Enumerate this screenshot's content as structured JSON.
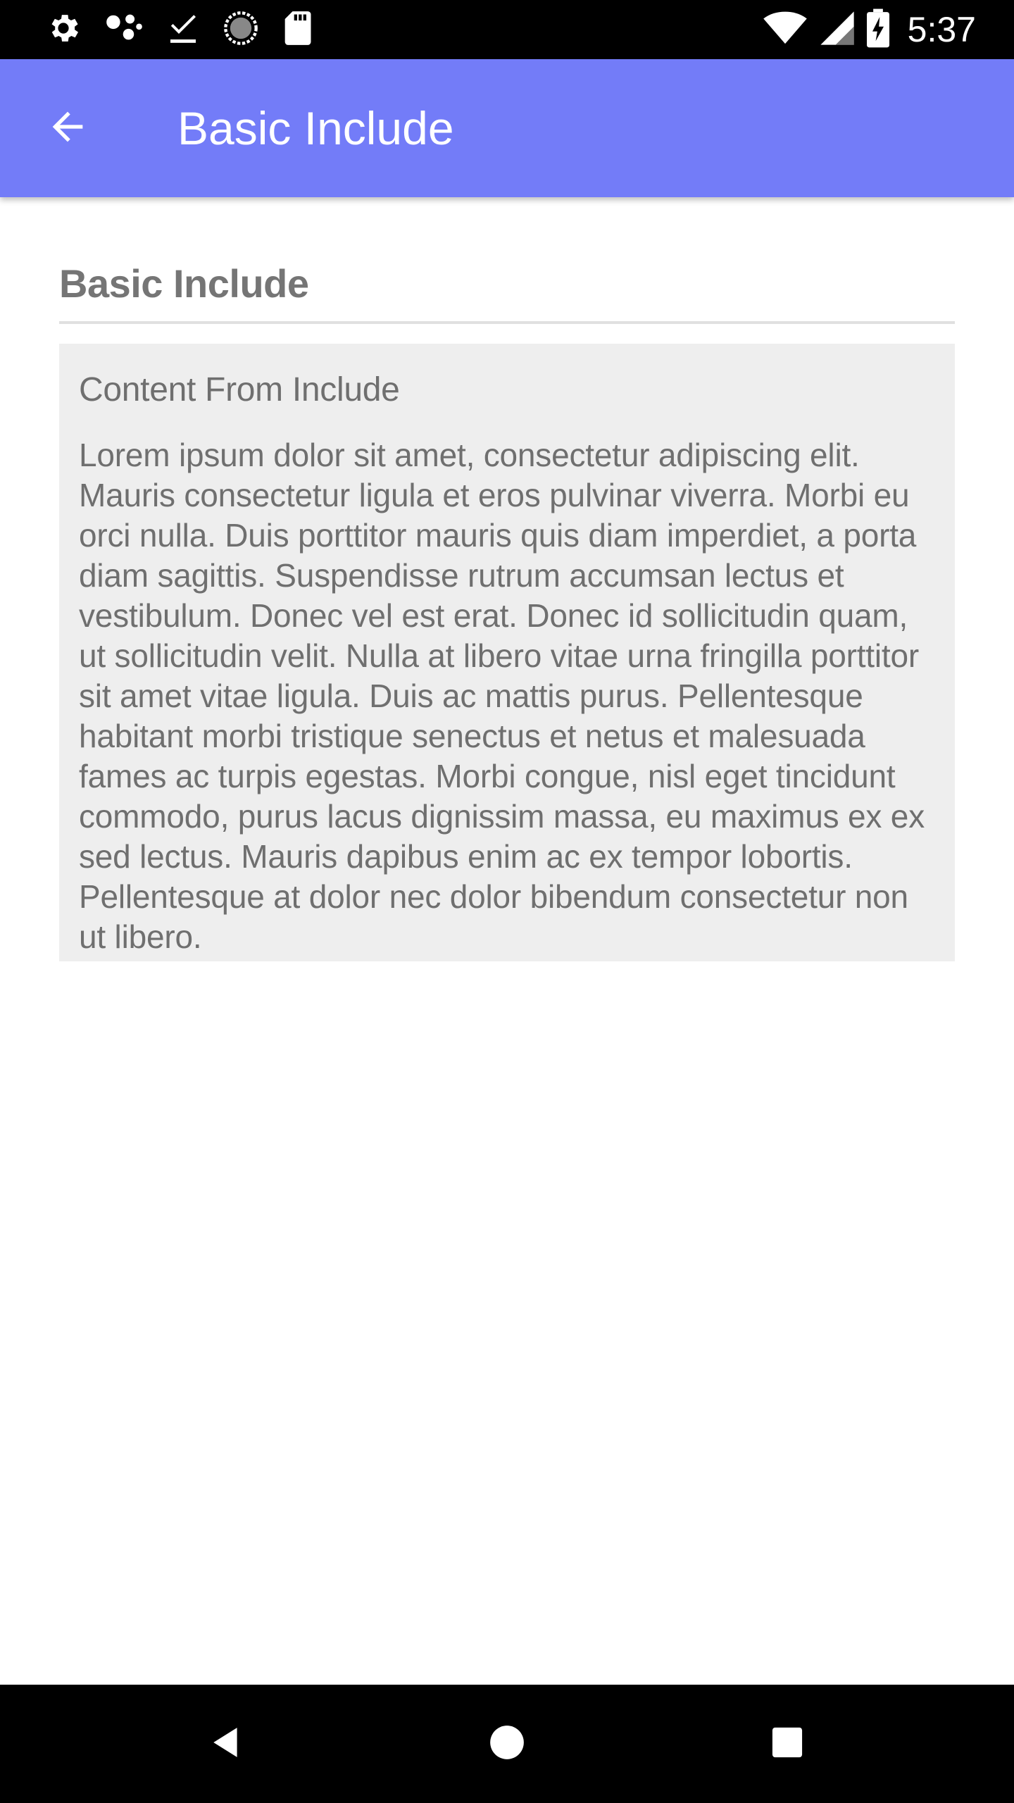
{
  "status_bar": {
    "time": "5:37",
    "left_icons": [
      "settings-icon",
      "assistant-icon",
      "download-done-icon",
      "sync-icon",
      "sd-card-icon"
    ],
    "right_icons": [
      "wifi-icon",
      "cell-signal-icon",
      "battery-charging-icon"
    ]
  },
  "app_bar": {
    "title": "Basic Include",
    "back_icon": "arrow-back-icon",
    "color": "#737cf8"
  },
  "main": {
    "section_title": "Basic Include",
    "include": {
      "heading": "Content From Include",
      "body": "Lorem ipsum dolor sit amet, consectetur adipiscing elit. Mauris consectetur ligula et eros pulvinar viverra. Morbi eu orci nulla. Duis porttitor mauris quis diam imperdiet, a porta diam sagittis. Suspendisse rutrum accumsan lectus et vestibulum. Donec vel est erat. Donec id sollicitudin quam, ut sollicitudin velit. Nulla at libero vitae urna fringilla porttitor sit amet vitae ligula. Duis ac mattis purus. Pellentesque habitant morbi tristique senectus et netus et malesuada fames ac turpis egestas. Morbi congue, nisl eget tincidunt commodo, purus lacus dignissim massa, eu maximus ex ex sed lectus. Mauris dapibus enim ac ex tempor lobortis. Pellentesque at dolor nec dolor bibendum consectetur non ut libero."
    }
  },
  "nav_bar": {
    "icons": [
      "back-triangle-icon",
      "home-circle-icon",
      "recents-square-icon"
    ]
  }
}
